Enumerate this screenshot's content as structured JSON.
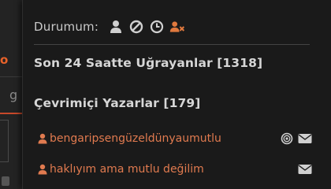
{
  "background_page": {
    "fragment_letter": "o",
    "fragment_glyph": "g"
  },
  "status": {
    "label": "Durumum:",
    "icons": [
      "user-icon",
      "ban-icon",
      "clock-icon",
      "user-x-icon"
    ]
  },
  "sections": {
    "recent_visitors": "Son 24 Saatte Uğrayanlar [1318]",
    "online_writers": "Çevrimiçi Yazarlar [179]"
  },
  "users": [
    {
      "name": "bengaripsengüzeldünyaumutlu",
      "icons": [
        "target-icon",
        "mail-icon"
      ]
    },
    {
      "name": "haklıyım ama mutlu değilim",
      "icons": [
        "mail-icon"
      ]
    }
  ],
  "colors": {
    "accent": "#e07a4f",
    "status_user_x": "#e0793e",
    "text": "#d6d6d6",
    "icon_grey": "#d0d0d0"
  }
}
